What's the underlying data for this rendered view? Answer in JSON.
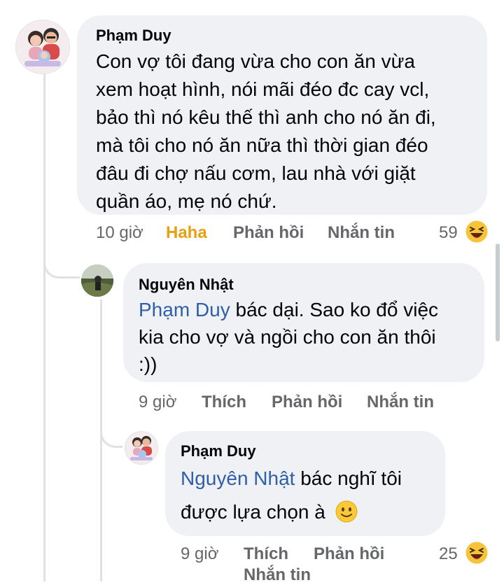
{
  "comments": [
    {
      "author": "Phạm Duy",
      "lines": [
        "Con vợ tôi đang vừa cho con ăn vừa",
        "xem hoạt hình, nói mãi đéo đc cay vcl,",
        "bảo thì nó kêu thế thì anh cho nó ăn đi,",
        "mà tôi cho nó ăn nữa thì thời gian đéo",
        "đâu đi chợ nấu cơm, lau nhà với giặt",
        "quần áo, mẹ nó chứ."
      ],
      "time": "10 giờ",
      "reaction_label": "Haha",
      "reply_label": "Phản hồi",
      "message_label": "Nhắn tin",
      "reaction_count": "59",
      "reaction_icon": "haha-reaction-icon"
    },
    {
      "author": "Nguyên Nhật",
      "mention": "Phạm Duy",
      "line1_rest": " bác dại. Sao ko đổ việc",
      "lines_rest": [
        "kia cho vợ và ngồi cho con ăn thôi",
        ":))"
      ],
      "time": "9 giờ",
      "like_label": "Thích",
      "reply_label": "Phản hồi",
      "message_label": "Nhắn tin"
    },
    {
      "author": "Phạm Duy",
      "mention": "Nguyên Nhật",
      "line1_rest": " bác nghĩ tôi",
      "line2": "được lựa chọn à",
      "emoji_icon": "slight-smile-emoji-icon",
      "time": "9 giờ",
      "like_label": "Thích",
      "reply_label": "Phản hồi",
      "message_label": "Nhắn tin",
      "reaction_count": "25",
      "reaction_icon": "haha-reaction-icon"
    }
  ],
  "colors": {
    "bubble": "#eff1f5",
    "mention": "#2f5fa7",
    "meta": "#65676b",
    "haha_active": "#e8a013"
  }
}
